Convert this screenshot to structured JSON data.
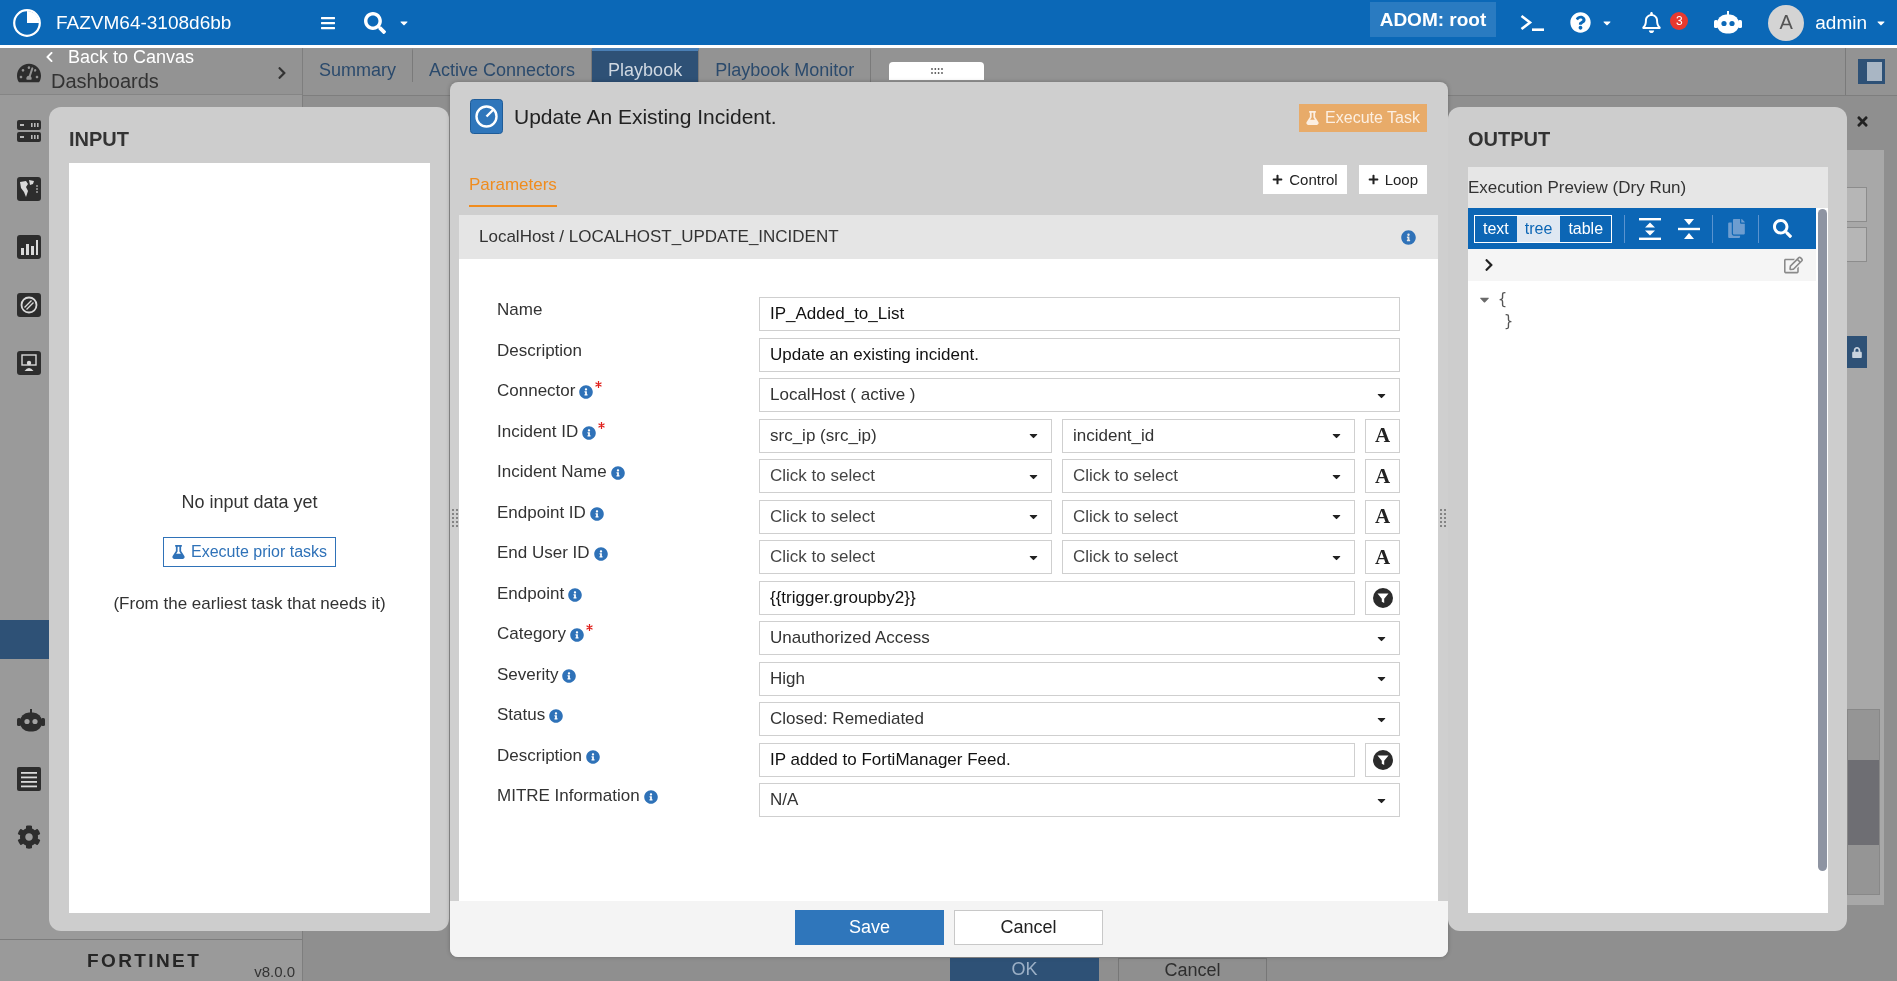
{
  "top_bar": {
    "title": "FAZVM64-3108d6bb",
    "adom": "ADOM: root",
    "notification_count": "3",
    "avatar": "A",
    "user": "admin"
  },
  "back_link": "Back to Canvas",
  "sidebar": {
    "header": "Dashboards",
    "items": [
      {
        "kind": "servers",
        "selected": false
      },
      {
        "kind": "map",
        "selected": false
      },
      {
        "kind": "chart",
        "selected": false
      },
      {
        "kind": "disc",
        "selected": false
      },
      {
        "kind": "monitor",
        "selected": false
      },
      {
        "kind": "entry",
        "selected": true
      },
      {
        "kind": "robot",
        "selected": false
      },
      {
        "kind": "list",
        "selected": false
      },
      {
        "kind": "gear",
        "selected": false
      }
    ],
    "logo": "FORTINET",
    "version": "v8.0.0"
  },
  "tabs": [
    {
      "label": "Summary",
      "selected": false
    },
    {
      "label": "Active Connectors",
      "selected": false
    },
    {
      "label": "Playbook",
      "selected": true
    },
    {
      "label": "Playbook Monitor",
      "selected": false
    }
  ],
  "dialog_buttons": [
    {
      "label": "OK",
      "kind": "primary"
    },
    {
      "label": "Cancel",
      "kind": "secondary"
    }
  ],
  "input_panel": {
    "title": "INPUT",
    "empty_text": "No input data yet",
    "button": "Execute prior tasks",
    "note": "(From the earliest task that needs it)"
  },
  "task_editor": {
    "title": "Update An Existing Incident.",
    "execute_button": {
      "label": "Execute Task",
      "disabled": true
    },
    "tabs": [
      {
        "label": "Parameters",
        "selected": true
      }
    ],
    "add_buttons": [
      "Control",
      "Loop"
    ],
    "breadcrumb": "LocalHost / LOCALHOST_UPDATE_INCIDENT",
    "fields": [
      {
        "label": "Name",
        "info": false,
        "required": false,
        "kind": "text",
        "value": "IP_Added_to_List"
      },
      {
        "label": "Description",
        "info": false,
        "required": false,
        "kind": "text",
        "value": "Update an existing incident."
      },
      {
        "label": "Connector",
        "info": true,
        "required": true,
        "kind": "select",
        "value": "LocalHost ( active )"
      },
      {
        "label": "Incident ID",
        "info": true,
        "required": true,
        "kind": "pair",
        "options": [
          {
            "value": "src_ip (src_ip)"
          },
          {
            "value": "incident_id"
          }
        ],
        "toggle": "A"
      },
      {
        "label": "Incident Name",
        "info": true,
        "required": false,
        "kind": "pair",
        "options": [
          {
            "placeholder": "Click to select"
          },
          {
            "placeholder": "Click to select"
          }
        ],
        "toggle": "A"
      },
      {
        "label": "Endpoint ID",
        "info": true,
        "required": false,
        "kind": "pair",
        "options": [
          {
            "placeholder": "Click to select"
          },
          {
            "placeholder": "Click to select"
          }
        ],
        "toggle": "A"
      },
      {
        "label": "End User ID",
        "info": true,
        "required": false,
        "kind": "pair",
        "options": [
          {
            "placeholder": "Click to select"
          },
          {
            "placeholder": "Click to select"
          }
        ],
        "toggle": "A"
      },
      {
        "label": "Endpoint",
        "info": true,
        "required": false,
        "kind": "expression",
        "value": "{{trigger.groupby2}}"
      },
      {
        "label": "Category",
        "info": true,
        "required": true,
        "kind": "select",
        "value": "Unauthorized Access"
      },
      {
        "label": "Severity",
        "info": true,
        "required": false,
        "kind": "select",
        "value": "High"
      },
      {
        "label": "Status",
        "info": true,
        "required": false,
        "kind": "select",
        "value": "Closed: Remediated"
      },
      {
        "label": "Description",
        "info": true,
        "required": false,
        "kind": "expression",
        "value": "IP added to FortiManager Feed."
      },
      {
        "label": "MITRE Information",
        "info": true,
        "required": false,
        "kind": "select",
        "value": "N/A"
      }
    ],
    "buttons": [
      {
        "label": "Save",
        "kind": "primary"
      },
      {
        "label": "Cancel",
        "kind": "secondary"
      }
    ]
  },
  "output_panel": {
    "title": "OUTPUT",
    "header": "Execution Preview (Dry Run)",
    "modes": [
      {
        "label": "text",
        "selected": false
      },
      {
        "label": "tree",
        "selected": true
      },
      {
        "label": "table",
        "selected": false
      }
    ],
    "tools": [
      {
        "kind": "expand_all",
        "disabled": false
      },
      {
        "kind": "collapse_all",
        "disabled": false
      },
      {
        "kind": "copy",
        "disabled": true
      },
      {
        "kind": "search",
        "disabled": false
      }
    ],
    "tree": {
      "expanded": true,
      "open": "{",
      "close": "}"
    }
  }
}
